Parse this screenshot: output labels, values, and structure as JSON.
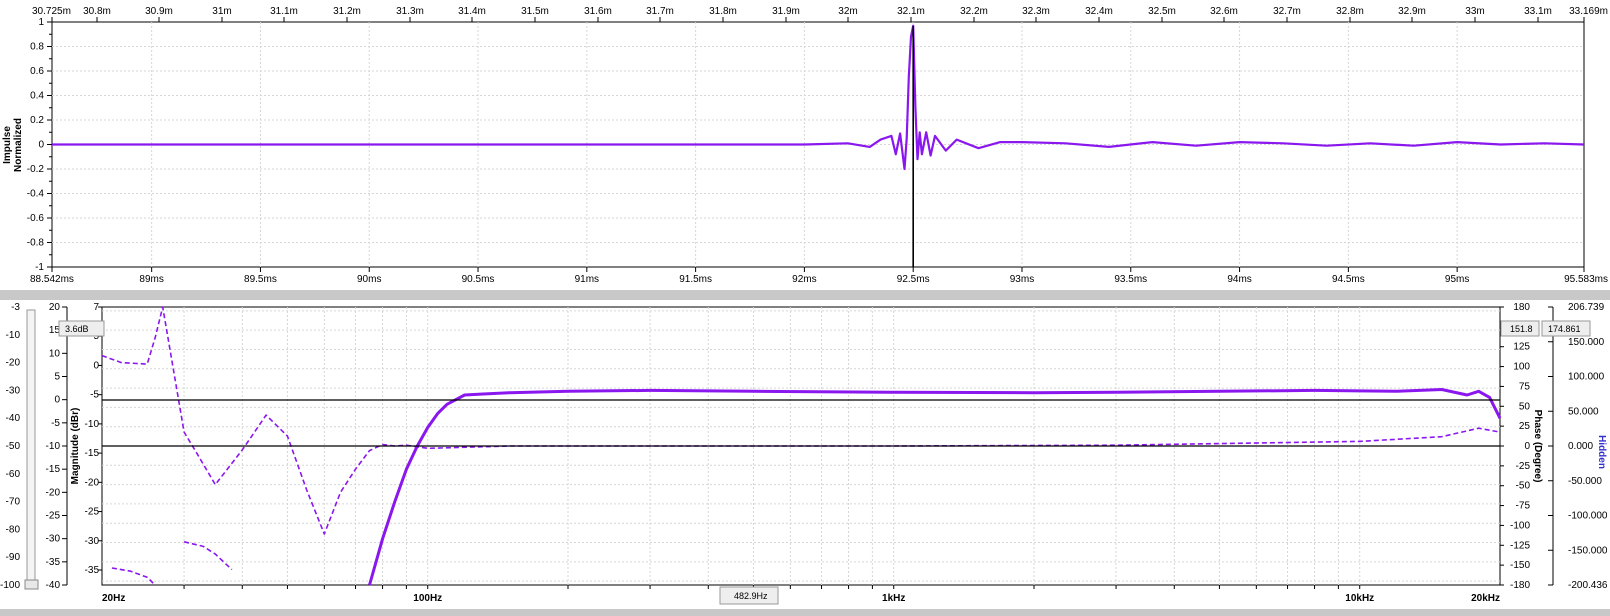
{
  "colors": {
    "trace": "#8a17ee",
    "grid": "#d6d6d6",
    "splitter": "#c8c8c8",
    "cursor": "#000000",
    "hidden_label": "#3333cc"
  },
  "top": {
    "ylabel_line1": "Impulse",
    "ylabel_line2": "Normalized",
    "top_ticks": [
      "30.725m",
      "30.8m",
      "30.9m",
      "31m",
      "31.1m",
      "31.2m",
      "31.3m",
      "31.4m",
      "31.5m",
      "31.6m",
      "31.7m",
      "31.8m",
      "31.9m",
      "32m",
      "32.1m",
      "32.2m",
      "32.3m",
      "32.4m",
      "32.5m",
      "32.6m",
      "32.7m",
      "32.8m",
      "32.9m",
      "33m",
      "33.1m",
      "33.169m"
    ],
    "bottom_ticks": [
      "88.542ms",
      "89ms",
      "89.5ms",
      "90ms",
      "90.5ms",
      "91ms",
      "91.5ms",
      "92ms",
      "92.5ms",
      "93ms",
      "93.5ms",
      "94ms",
      "94.5ms",
      "95ms",
      "95.583ms"
    ],
    "yticks": [
      "1",
      "0.8",
      "0.6",
      "0.4",
      "0.2",
      "0",
      "-0.2",
      "-0.4",
      "-0.6",
      "-0.8",
      "-1"
    ]
  },
  "bottom": {
    "ylabel_left": "Magnitude (dBr)",
    "ylabel_right": "Phase (Degree)",
    "ylabel_far": "Hidden",
    "axis_outer_left": [
      "-3",
      "-10",
      "-20",
      "-30",
      "-40",
      "-50",
      "-60",
      "-70",
      "-80",
      "-90",
      "-100"
    ],
    "axis_left1": [
      "20",
      "15",
      "10",
      "5",
      "0",
      "-5",
      "-10",
      "-15",
      "-20",
      "-25",
      "-30",
      "-35",
      "-40"
    ],
    "axis_left2": [
      "7",
      "5",
      "0",
      "-5",
      "-10",
      "-15",
      "-20",
      "-25",
      "-30",
      "-35"
    ],
    "axis_phase": [
      "180",
      "150",
      "125",
      "100",
      "75",
      "50",
      "25",
      "0",
      "-25",
      "-50",
      "-75",
      "-100",
      "-125",
      "-150",
      "-180"
    ],
    "axis_hidden": [
      "206.739",
      "150.000",
      "100.000",
      "50.000",
      "0.000",
      "-50.000",
      "-100.000",
      "-150.000",
      "-200.436"
    ],
    "freq_ticks": [
      "20Hz",
      "100Hz",
      "1kHz",
      "10kHz",
      "20kHz"
    ],
    "cursor_left_box": "3.6dB",
    "cursor_right_box1": "151.8",
    "cursor_right_box2": "174.861",
    "cursor_freq_box": "482.9Hz"
  },
  "chart_data": [
    {
      "type": "line",
      "title": "",
      "xlabel": "",
      "ylabel": "Impulse Normalized",
      "xlim": [
        88.542,
        95.583
      ],
      "ylim": [
        -1,
        1
      ],
      "x_unit": "ms",
      "grid": true,
      "cursor_x": 92.5,
      "series": [
        {
          "x": [
            88.542,
            89.0,
            89.5,
            90.0,
            90.5,
            91.0,
            91.5,
            92.0,
            92.2,
            92.3,
            92.35,
            92.4,
            92.42,
            92.44,
            92.46,
            92.47,
            92.48,
            92.49,
            92.5,
            92.51,
            92.52,
            92.53,
            92.54,
            92.56,
            92.58,
            92.6,
            92.65,
            92.7,
            92.8,
            92.9,
            93.0,
            93.2,
            93.4,
            93.6,
            93.8,
            94.0,
            94.2,
            94.4,
            94.6,
            94.8,
            95.0,
            95.2,
            95.4,
            95.583
          ],
          "y": [
            0,
            0,
            0,
            0,
            0,
            0,
            0,
            0,
            0.01,
            -0.02,
            0.04,
            0.07,
            -0.08,
            0.09,
            -0.2,
            0.05,
            0.55,
            0.88,
            0.97,
            0.3,
            -0.12,
            0.1,
            -0.08,
            0.1,
            -0.09,
            0.07,
            -0.05,
            0.04,
            -0.03,
            0.02,
            0.02,
            0.01,
            -0.02,
            0.02,
            -0.01,
            0.02,
            0.01,
            -0.01,
            0.01,
            -0.01,
            0.02,
            0.0,
            0.01,
            0.0
          ]
        }
      ]
    },
    {
      "type": "line",
      "title": "",
      "xlabel": "",
      "ylabel": "Magnitude (dBr)",
      "xscale": "log",
      "xlim": [
        20,
        20000
      ],
      "ylim": [
        -40,
        20
      ],
      "y2label": "Phase (Degree)",
      "y2lim": [
        -180,
        180
      ],
      "grid": true,
      "series": [
        {
          "axis": "magnitude",
          "style": "solid",
          "x": [
            75,
            80,
            85,
            90,
            95,
            100,
            105,
            110,
            120,
            130,
            150,
            200,
            300,
            500,
            1000,
            2000,
            3000,
            5000,
            8000,
            10000,
            12000,
            15000,
            17000,
            18000,
            19000,
            20000
          ],
          "y": [
            -40,
            -30,
            -22,
            -15,
            -10,
            -6,
            -3,
            -1,
            1,
            1.2,
            1.5,
            1.8,
            2,
            1.8,
            1.6,
            1.5,
            1.6,
            1.8,
            2,
            1.9,
            1.8,
            2.2,
            1.0,
            1.8,
            0.5,
            -4
          ]
        },
        {
          "axis": "phase",
          "style": "dashed",
          "x": [
            20,
            22,
            25,
            26,
            27,
            30,
            32,
            35,
            40,
            45,
            50,
            55,
            60,
            65,
            70,
            75,
            80,
            85,
            90,
            100,
            150,
            300,
            1000,
            3000,
            10000,
            15000,
            18000,
            20000
          ],
          "y": [
            117,
            108,
            106,
            140,
            180,
            18,
            -10,
            -50,
            -5,
            40,
            13,
            -57,
            -114,
            -60,
            -30,
            -6,
            2,
            0,
            1,
            -3,
            0,
            0,
            0,
            1,
            6,
            12,
            23,
            18
          ]
        },
        {
          "axis": "phase",
          "style": "dashed",
          "x": [
            21,
            23,
            25,
            26
          ],
          "y": [
            -158,
            -162,
            -170,
            -180
          ]
        },
        {
          "axis": "phase",
          "style": "dashed",
          "x": [
            30,
            33,
            35,
            38
          ],
          "y": [
            -124,
            -130,
            -140,
            -160
          ]
        }
      ]
    }
  ]
}
